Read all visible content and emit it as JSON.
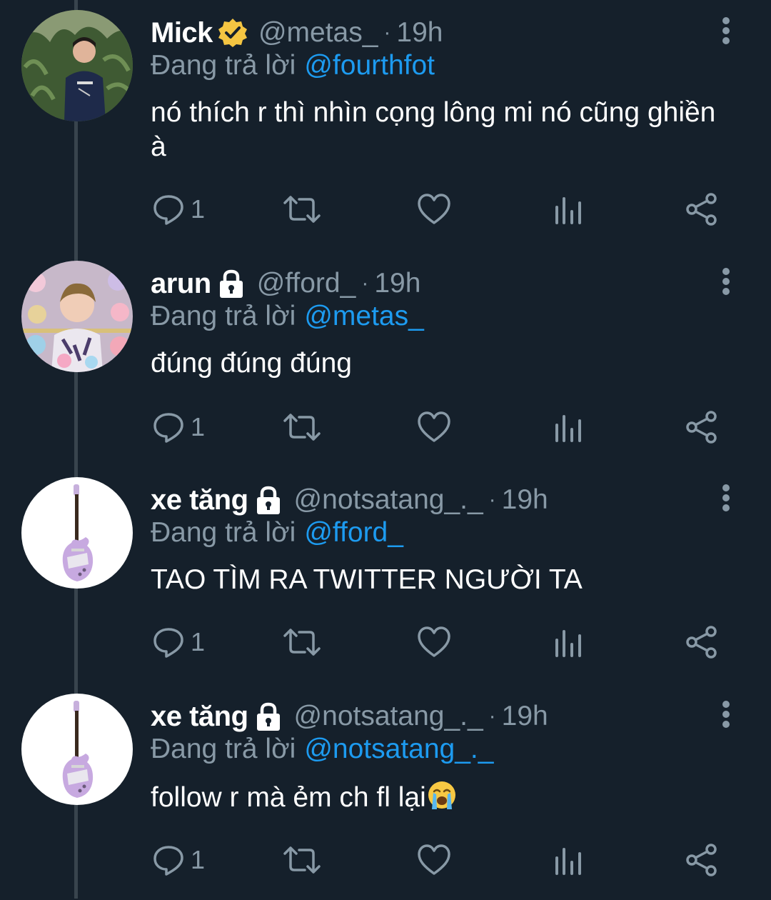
{
  "tweets": [
    {
      "display_name": "Mick",
      "verified": true,
      "locked": false,
      "handle": "@metas_",
      "separator": "·",
      "time": "19h",
      "reply_label": "Đang trả lời",
      "reply_to": "@fourthfot",
      "text": "nó thích r thì nhìn cọng lông mi nó cũng ghiền à",
      "reply_count": "1",
      "avatar": "photo-man-dark-sweater-plants"
    },
    {
      "display_name": "arun",
      "verified": false,
      "locked": true,
      "handle": "@fford_",
      "separator": "·",
      "time": "19h",
      "reply_label": "Đang trả lời",
      "reply_to": "@metas_",
      "text": "đúng đúng đúng",
      "reply_count": "1",
      "avatar": "photo-man-plush-toys"
    },
    {
      "display_name": "xe tăng",
      "verified": false,
      "locked": true,
      "handle": "@notsatang_._",
      "separator": "·",
      "time": "19h",
      "reply_label": "Đang trả lời",
      "reply_to": "@fford_",
      "text": "TAO TÌM RA TWITTER NGƯỜI TA",
      "reply_count": "1",
      "avatar": "purple-guitar"
    },
    {
      "display_name": "xe tăng",
      "verified": false,
      "locked": true,
      "handle": "@notsatang_._",
      "separator": "·",
      "time": "19h",
      "reply_label": "Đang trả lời",
      "reply_to": "@notsatang_._",
      "text": "follow r mà ẻm ch fl lại",
      "emoji": "crying-face-emoji",
      "reply_count": "1",
      "avatar": "purple-guitar"
    }
  ],
  "colors": {
    "background": "#15202b",
    "text": "#ffffff",
    "muted": "#8899a6",
    "link": "#1d9bf0",
    "verified": "#f4c542"
  },
  "icons": {
    "reply": "reply-icon",
    "retweet": "retweet-icon",
    "like": "heart-icon",
    "views": "analytics-icon",
    "share": "share-icon",
    "more": "more-vertical-icon",
    "verified": "verified-badge-icon",
    "protected": "lock-icon"
  }
}
